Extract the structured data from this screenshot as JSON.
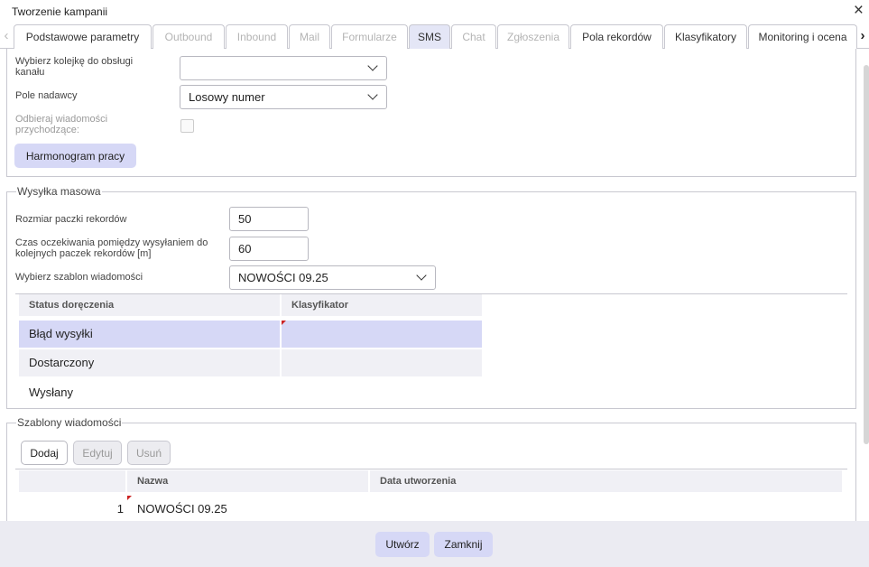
{
  "window": {
    "title": "Tworzenie kampanii"
  },
  "tabs": [
    {
      "label": "Podstawowe parametry",
      "state": "active"
    },
    {
      "label": "Outbound",
      "state": "disabled"
    },
    {
      "label": "Inbound",
      "state": "disabled"
    },
    {
      "label": "Mail",
      "state": "disabled"
    },
    {
      "label": "Formularze",
      "state": "disabled"
    },
    {
      "label": "SMS",
      "state": "enabled"
    },
    {
      "label": "Chat",
      "state": "disabled"
    },
    {
      "label": "Zgłoszenia",
      "state": "disabled"
    },
    {
      "label": "Pola rekordów",
      "state": "enabled"
    },
    {
      "label": "Klasyfikatory",
      "state": "enabled"
    },
    {
      "label": "Monitoring i ocena",
      "state": "enabled"
    }
  ],
  "channel": {
    "queue_label": "Wybierz kolejkę do obsługi kanału",
    "queue_value": "",
    "sender_label": "Pole nadawcy",
    "sender_value": "Losowy numer",
    "incoming_label": "Odbieraj wiadomości przychodzące:",
    "incoming_checked": false,
    "schedule_button": "Harmonogram pracy"
  },
  "mass": {
    "legend": "Wysyłka masowa",
    "batch_label": "Rozmiar paczki rekordów",
    "batch_value": "50",
    "wait_label": "Czas oczekiwania pomiędzy wysyłaniem do kolejnych paczek rekordów [m]",
    "wait_value": "60",
    "template_label": "Wybierz szablon wiadomości",
    "template_value": "NOWOŚCI 09.25",
    "status_table": {
      "headers": [
        "Status doręczenia",
        "Klasyfikator"
      ],
      "rows": [
        {
          "status": "Błąd wysyłki",
          "classifier": ""
        },
        {
          "status": "Dostarczony",
          "classifier": ""
        },
        {
          "status": "Wysłany",
          "classifier": ""
        }
      ]
    }
  },
  "templates": {
    "legend": "Szablony wiadomości",
    "add_button": "Dodaj",
    "edit_button": "Edytuj",
    "delete_button": "Usuń",
    "headers": [
      "Nazwa",
      "Data utworzenia"
    ],
    "rows": [
      {
        "index": "1",
        "name": "NOWOŚCI 09.25",
        "created": ""
      }
    ]
  },
  "footer": {
    "create_button": "Utwórz",
    "close_button": "Zamknij"
  },
  "colors": {
    "accent": "#d6d8f6",
    "selected_row": "#d6d8f6",
    "dirty_marker": "#cc2222"
  }
}
